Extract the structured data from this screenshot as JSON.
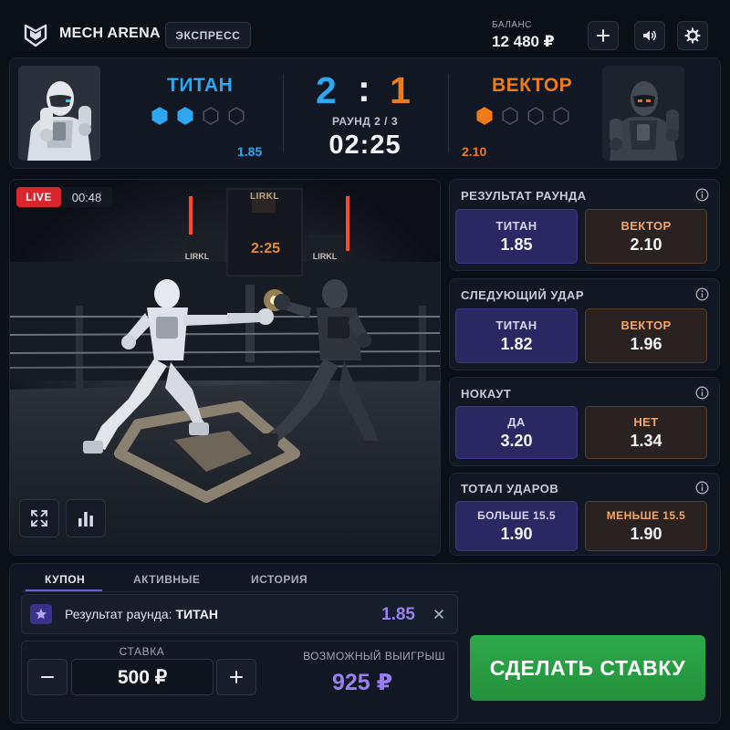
{
  "app": {
    "title": "MECH ARENA",
    "express_label": "ЭКСПРЕСС"
  },
  "balance": {
    "label": "БАЛАНС",
    "value": "12 480 ₽"
  },
  "header_icons": [
    "plus-icon",
    "volume-icon",
    "gear-icon"
  ],
  "match": {
    "team_left": {
      "name": "ТИТАН",
      "odds": "1.85",
      "rounds_won": 2,
      "rounds_total": 4,
      "color": "#2ea6f0"
    },
    "team_right": {
      "name": "ВЕКТОР",
      "odds": "2.10",
      "rounds_won": 1,
      "rounds_total": 4,
      "color": "#f07a16"
    },
    "score_left": "2",
    "score_sep": ":",
    "score_right": "1",
    "round": "РАУНД 2 / 3",
    "timer": "02:25"
  },
  "stream": {
    "live_label": "LIVE",
    "elapsed": "00:48",
    "banner_logo": "LIRKL",
    "banner_time": "2:25",
    "side_logo": "LIRKL"
  },
  "markets": [
    {
      "title": "РЕЗУЛЬТАТ РАУНДА",
      "left": {
        "label": "ТИТАН",
        "odds": "1.85"
      },
      "right": {
        "label": "ВЕКТОР",
        "odds": "2.10"
      }
    },
    {
      "title": "СЛЕДУЮЩИЙ УДАР",
      "left": {
        "label": "ТИТАН",
        "odds": "1.82"
      },
      "right": {
        "label": "ВЕКТОР",
        "odds": "1.96"
      }
    },
    {
      "title": "НОКАУТ",
      "left": {
        "label": "ДА",
        "odds": "3.20"
      },
      "right": {
        "label": "НЕТ",
        "odds": "1.34"
      }
    },
    {
      "title": "ТОТАЛ УДАРОВ",
      "left": {
        "label": "БОЛЬШЕ 15.5",
        "odds": "1.90"
      },
      "right": {
        "label": "МЕНЬШЕ 15.5",
        "odds": "1.90"
      }
    }
  ],
  "slip": {
    "tabs": [
      "КУПОН",
      "АКТИВНЫЕ",
      "ИСТОРИЯ"
    ],
    "active_tab": "КУПОН",
    "selection": {
      "market": "Результат раунда:",
      "pick": "ТИТАН",
      "odds": "1.85"
    },
    "stake_label": "СТАВКА",
    "stake_value": "500 ₽",
    "win_label": "ВОЗМОЖНЫЙ ВЫИГРЫШ",
    "win_value": "925 ₽",
    "place_bet": "СДЕЛАТЬ СТАВКУ"
  },
  "colors": {
    "accent_purple": "#9a7ff0",
    "live_red": "#d8262c",
    "cta_green": "#2ea94a",
    "left_blue": "#2ea6f0",
    "right_orange": "#f07a16"
  }
}
